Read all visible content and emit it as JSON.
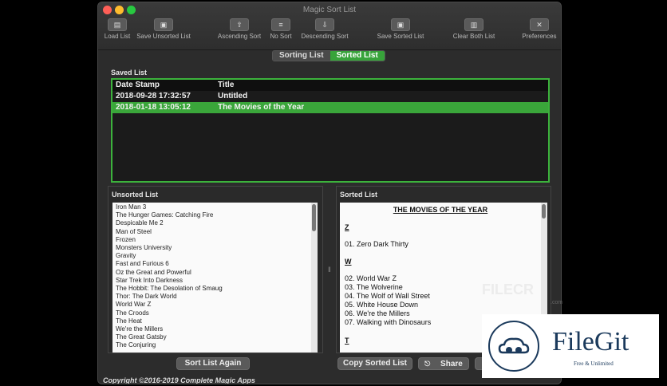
{
  "window": {
    "title": "Magic Sort List"
  },
  "toolbar": [
    {
      "label": "Load List",
      "icon": "document-icon"
    },
    {
      "label": "Save Unsorted List",
      "icon": "save-icon"
    },
    {
      "label": "Ascending Sort",
      "icon": "sort-ascending-icon"
    },
    {
      "label": "No Sort",
      "icon": "list-icon"
    },
    {
      "label": "Descending Sort",
      "icon": "sort-descending-icon"
    },
    {
      "label": "Save Sorted List",
      "icon": "save-icon"
    },
    {
      "label": "Clear Both List",
      "icon": "trash-icon"
    },
    {
      "label": "Preferences",
      "icon": "tools-icon"
    }
  ],
  "tabs": {
    "sorting": "Sorting List",
    "sorted": "Sorted List"
  },
  "saved_list": {
    "label": "Saved List",
    "col_date": "Date Stamp",
    "col_title": "Title",
    "rows": [
      {
        "date": "2018-09-28 17:32:57",
        "title": "Untitled"
      },
      {
        "date": "2018-01-18 13:05:12",
        "title": "The Movies of the Year"
      }
    ]
  },
  "unsorted": {
    "label": "Unsorted List",
    "items": [
      "Iron Man 3",
      "The Hunger Games: Catching Fire",
      "Despicable Me 2",
      "Man of Steel",
      "Frozen",
      "Monsters University",
      "Gravity",
      "Fast and Furious 6",
      "Oz the Great and Powerful",
      "Star Trek Into Darkness",
      "The Hobbit: The Desolation of Smaug",
      "Thor: The Dark World",
      "World War Z",
      "The Croods",
      "The Heat",
      "We're the Millers",
      "The Great Gatsby",
      "The Conjuring"
    ]
  },
  "sorted": {
    "label": "Sorted List",
    "heading": "THE MOVIES OF THE YEAR",
    "letter_z": "Z",
    "z_items": [
      "01. Zero Dark Thirty"
    ],
    "letter_w": "W",
    "w_items": [
      "02. World War Z",
      "03. The Wolverine",
      "04. The Wolf of Wall Street",
      "05. White House Down",
      "06. We're the Millers",
      "07. Walking with Dinosaurs"
    ],
    "letter_t": "T"
  },
  "buttons": {
    "sort_again": "Sort List Again",
    "copy_sorted": "Copy Sorted List",
    "share": "Share"
  },
  "copyright": "Copyright ©2016-2019 Complete Magic Apps",
  "watermark": {
    "filecr": "FILECR",
    "filecr_sub": ".com",
    "filegit": "FileGit",
    "filegit_sub": "Free & Unlimited"
  },
  "colors": {
    "accent": "#3aa63a",
    "close": "#ff5f57",
    "minimize": "#febc2e",
    "zoom": "#28c840"
  }
}
